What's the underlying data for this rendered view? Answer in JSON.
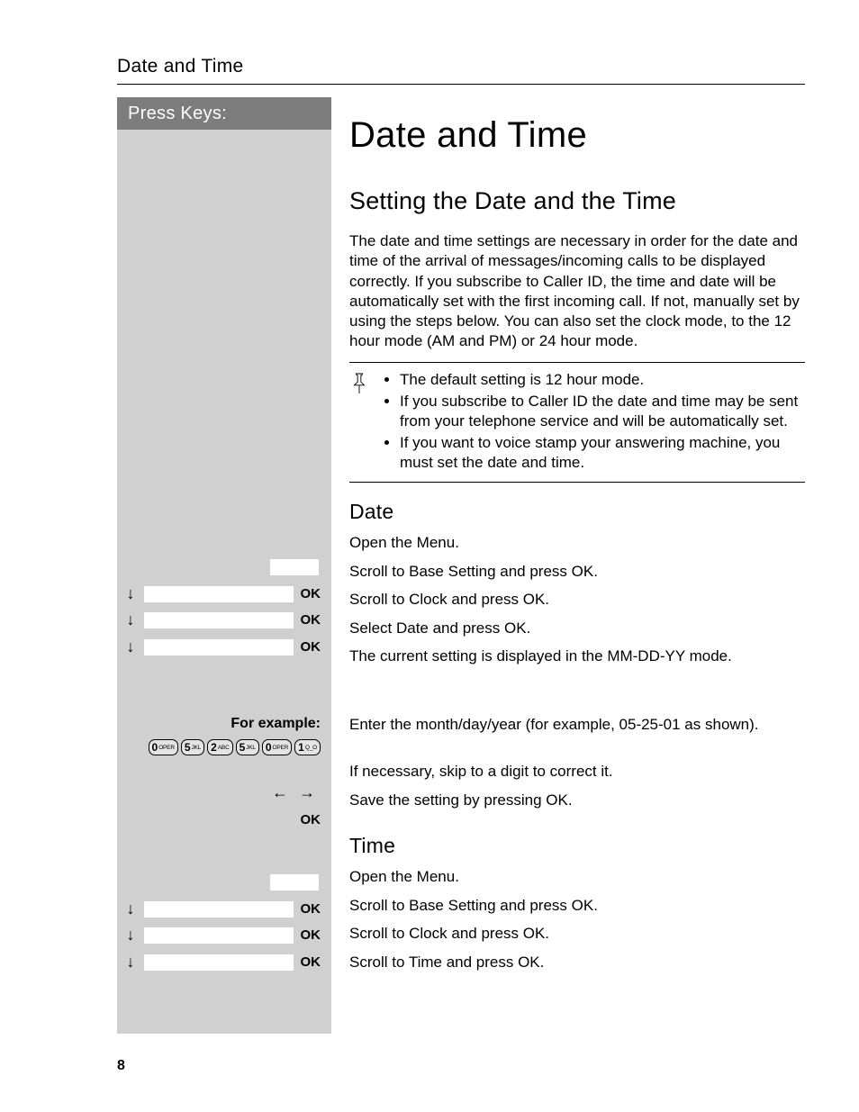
{
  "running_header": "Date and Time",
  "sidebar": {
    "press_keys_label": "Press Keys:",
    "ok_label": "OK",
    "for_example_label": "For example:",
    "date_keys": [
      {
        "digit": "0",
        "letters": "OPER"
      },
      {
        "digit": "5",
        "letters": "JKL"
      },
      {
        "digit": "2",
        "letters": "ABC"
      },
      {
        "digit": "5",
        "letters": "JKL"
      },
      {
        "digit": "0",
        "letters": "OPER"
      },
      {
        "digit": "1",
        "letters": "Q_O"
      }
    ]
  },
  "main": {
    "chapter_title": "Date and Time",
    "section_title": "Setting the Date and the Time",
    "intro": "The date and time settings are necessary in order for the date and time of the arrival of messages/incoming calls to be displayed correctly. If you subscribe to Caller ID, the time and date will be automatically set with the first incoming call. If not, manually set by using the steps below. You can also set the clock mode, to the 12 hour mode (AM and PM) or 24 hour mode.",
    "notes": [
      "The default setting is 12 hour mode.",
      "If you subscribe to Caller ID the date and time may be sent from your telephone service and will be automatically set.",
      "If you want to voice stamp your answering machine, you must set the date and time."
    ],
    "date": {
      "heading": "Date",
      "steps": [
        "Open the Menu.",
        "Scroll to Base Setting and press OK.",
        "Scroll to Clock and press OK.",
        "Select Date and press OK.",
        "The current setting is displayed in the MM-DD-YY mode.",
        "Enter the month/day/year (for example, 05-25-01 as shown).",
        "If necessary, skip to a digit to correct it.",
        "Save the setting by pressing OK."
      ]
    },
    "time": {
      "heading": "Time",
      "steps": [
        "Open the Menu.",
        "Scroll to Base Setting and press OK.",
        "Scroll to Clock and press OK.",
        "Scroll to Time and press OK."
      ]
    }
  },
  "page_number": "8"
}
